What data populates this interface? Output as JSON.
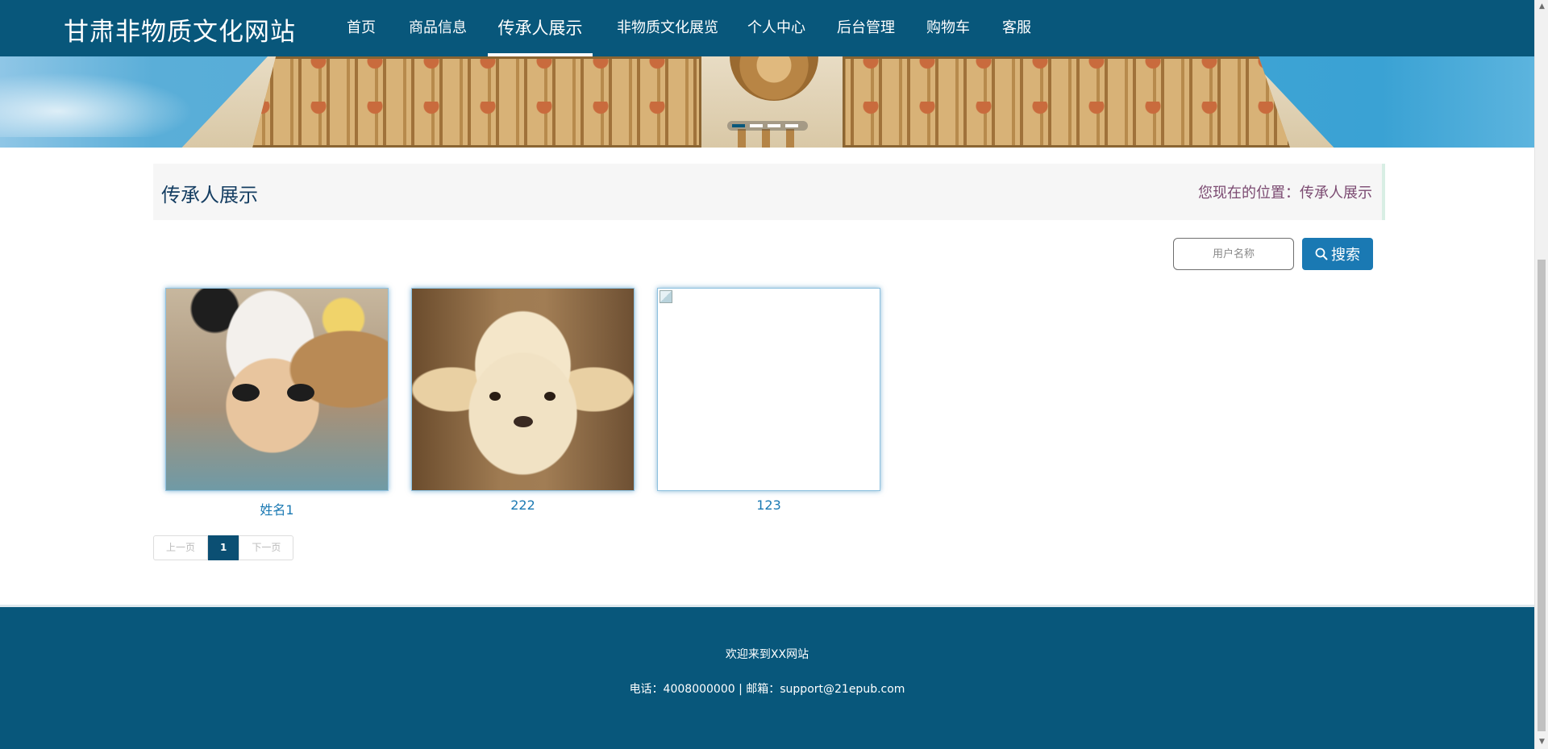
{
  "header": {
    "site_title": "甘肃非物质文化网站",
    "nav": [
      {
        "label": "首页"
      },
      {
        "label": "商品信息"
      },
      {
        "label": "传承人展示",
        "active": true
      },
      {
        "label": "非物质文化展览"
      },
      {
        "label": "个人中心"
      },
      {
        "label": "后台管理"
      },
      {
        "label": "购物车"
      },
      {
        "label": "客服"
      }
    ]
  },
  "banner": {
    "slide_count": 4,
    "active_slide": 1
  },
  "breadcrumb": {
    "title": "传承人展示",
    "location_prefix": "您现在的位置：",
    "location": "传承人展示"
  },
  "search": {
    "placeholder": "用户名称",
    "value": "",
    "button_label": "搜索",
    "button_icon": "search-icon"
  },
  "cards": [
    {
      "name": "姓名1",
      "image": "cat-wearing-panda-hat"
    },
    {
      "name": "222",
      "image": "fluffy-puppy"
    },
    {
      "name": "123",
      "image": "broken-image"
    }
  ],
  "pagination": {
    "prev_label": "上一页",
    "current_page": "1",
    "next_label": "下一页"
  },
  "footer": {
    "welcome": "欢迎来到XX网站",
    "contact": "电话：4008000000 | 邮箱：support@21epub.com"
  },
  "colors": {
    "primary": "#08577b",
    "accent": "#1a79b3",
    "breadcrumb_location": "#7b4a71"
  }
}
